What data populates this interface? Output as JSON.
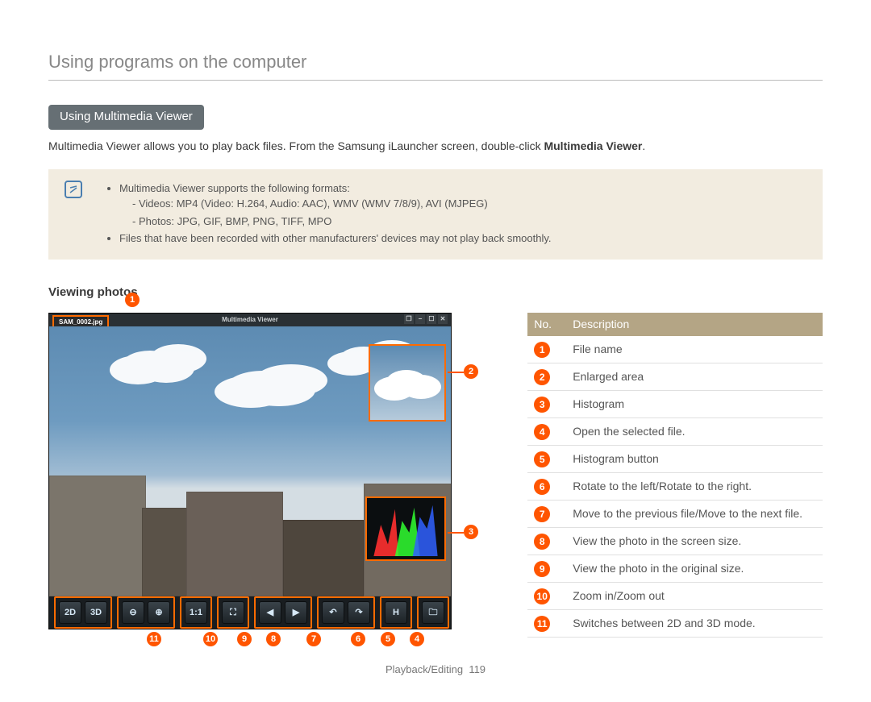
{
  "page_title": "Using programs on the computer",
  "section_pill": "Using Multimedia Viewer",
  "intro_text_1": "Multimedia Viewer allows you to play back files. From the Samsung iLauncher screen, double-click ",
  "intro_bold": "Multimedia Viewer",
  "intro_tail": ".",
  "note": {
    "line1": "Multimedia Viewer supports the following formats:",
    "line1a": "Videos: MP4 (Video: H.264, Audio: AAC), WMV (WMV 7/8/9), AVI (MJPEG)",
    "line1b": "Photos: JPG, GIF, BMP, PNG, TIFF, MPO",
    "line2": "Files that have been recorded with other manufacturers' devices may not play back smoothly."
  },
  "sub_heading": "Viewing photos",
  "viewer": {
    "window_title": "Multimedia Viewer",
    "file_badge": "SAM_0002.jpg"
  },
  "table": {
    "head_no": "No.",
    "head_desc": "Description",
    "rows": [
      {
        "n": "1",
        "d": "File name"
      },
      {
        "n": "2",
        "d": "Enlarged area"
      },
      {
        "n": "3",
        "d": "Histogram"
      },
      {
        "n": "4",
        "d": "Open the selected file."
      },
      {
        "n": "5",
        "d": "Histogram button"
      },
      {
        "n": "6",
        "d": "Rotate to the left/Rotate to the right."
      },
      {
        "n": "7",
        "d": "Move to the previous file/Move to the next file."
      },
      {
        "n": "8",
        "d": "View the photo in the screen size."
      },
      {
        "n": "9",
        "d": "View the photo in the original size."
      },
      {
        "n": "10",
        "d": "Zoom in/Zoom out"
      },
      {
        "n": "11",
        "d": "Switches between 2D and 3D mode."
      }
    ]
  },
  "footer_section": "Playback/Editing",
  "footer_page": "119",
  "callouts": {
    "c1": "1",
    "c2": "2",
    "c3": "3",
    "c4": "4",
    "c5": "5",
    "c6": "6",
    "c7": "7",
    "c8": "8",
    "c9": "9",
    "c10": "10",
    "c11": "11"
  }
}
